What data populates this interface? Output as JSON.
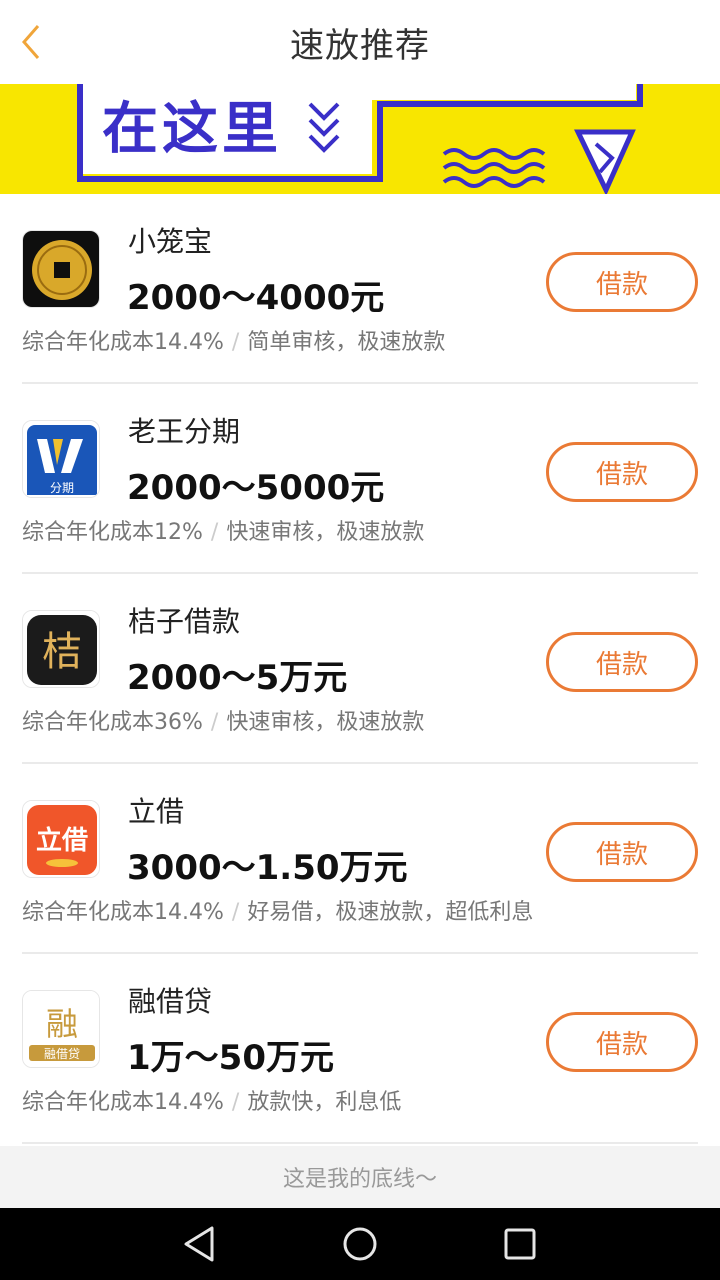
{
  "header": {
    "title": "速放推荐"
  },
  "banner": {
    "text": "在这里"
  },
  "loans": [
    {
      "name": "小笼宝",
      "range": "2000～4000元",
      "cost": "综合年化成本14.4%",
      "features": "简单审核，极速放款",
      "button": "借款"
    },
    {
      "name": "老王分期",
      "range": "2000～5000元",
      "cost": "综合年化成本12%",
      "features": "快速审核，极速放款",
      "button": "借款",
      "logo_text": "分期"
    },
    {
      "name": "桔子借款",
      "range": "2000～5万元",
      "cost": "综合年化成本36%",
      "features": "快速审核，极速放款",
      "button": "借款",
      "logo_text": "桔"
    },
    {
      "name": "立借",
      "range": "3000～1.50万元",
      "cost": "综合年化成本14.4%",
      "features": "好易借，极速放款，超低利息",
      "button": "借款",
      "logo_text": "立借"
    },
    {
      "name": "融借贷",
      "range": "1万～50万元",
      "cost": "综合年化成本14.4%",
      "features": "放款快，利息低",
      "button": "借款",
      "logo_text": "融",
      "logo_sub": "融借贷"
    }
  ],
  "footer": {
    "text": "这是我的底线～"
  },
  "colors": {
    "accent": "#ea7a35",
    "banner": "#f8e600",
    "banner_ink": "#3a2fc8"
  },
  "icons": [
    "back-icon",
    "nav-back-icon",
    "nav-home-icon",
    "nav-recents-icon"
  ]
}
